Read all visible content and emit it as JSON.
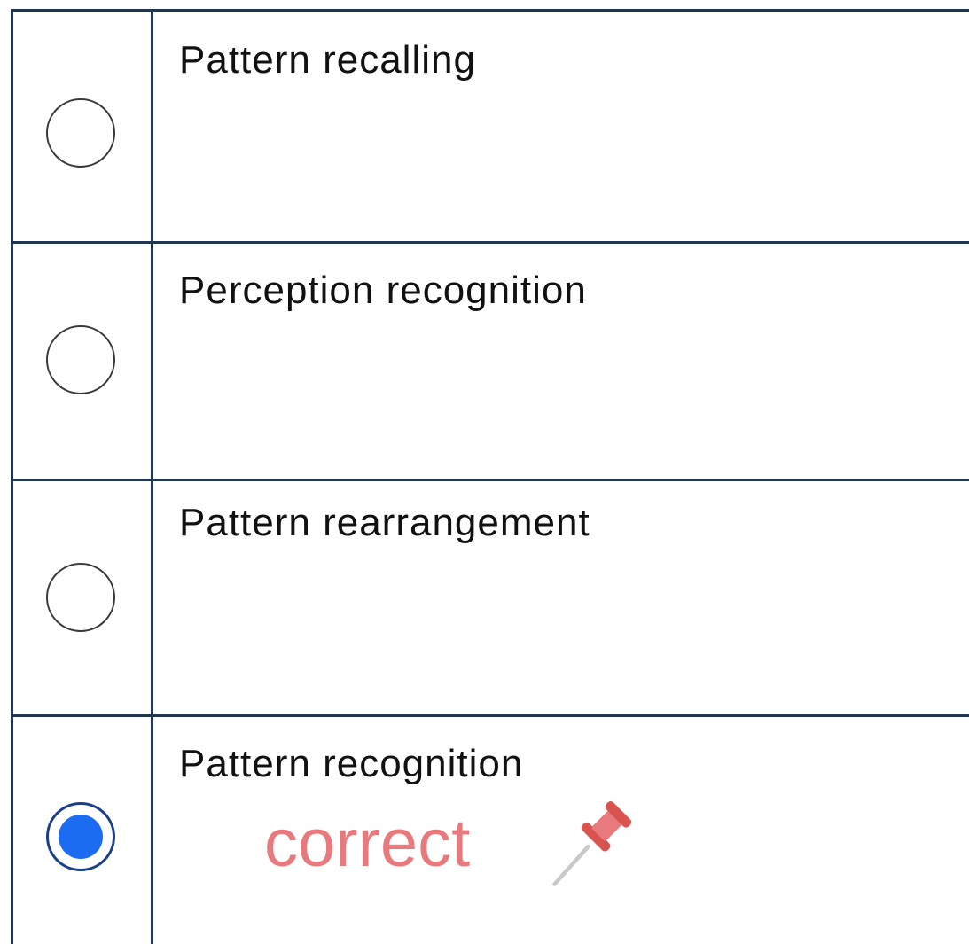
{
  "question": {
    "options": [
      {
        "label": "Pattern recalling",
        "selected": false
      },
      {
        "label": "Perception recognition",
        "selected": false
      },
      {
        "label": "Pattern rearrangement",
        "selected": false
      },
      {
        "label": "Pattern recognition",
        "selected": true
      }
    ],
    "annotation": {
      "text": "correct",
      "icon": "pushpin-icon",
      "color": "#e8797c"
    }
  },
  "colors": {
    "border": "#1f3550",
    "radio_selected": "#1c6cf2"
  }
}
